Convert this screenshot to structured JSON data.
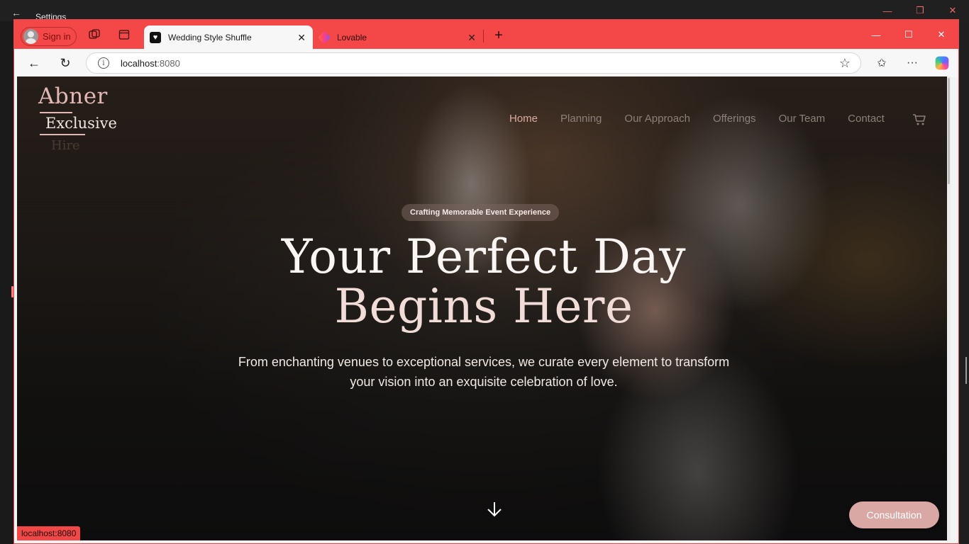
{
  "background_window": {
    "title": "Settings",
    "back_icon": "arrow-left-icon",
    "controls": [
      "minimize-icon",
      "restore-icon",
      "close-icon"
    ]
  },
  "browser": {
    "profile": {
      "label": "Sign in",
      "icon": "avatar-icon"
    },
    "tabs": [
      {
        "title": "Wedding Style Shuffle",
        "favicon": "heart-icon",
        "active": true
      },
      {
        "title": "Lovable",
        "favicon": "lovable-icon",
        "active": false
      }
    ],
    "address": {
      "host": "localhost",
      "port": ":8080"
    },
    "status_text": "localhost:8080",
    "accent_color": "#f44747"
  },
  "site": {
    "logo": {
      "line1": "Abner",
      "line2": "Exclusive",
      "line3": "Hire"
    },
    "nav": [
      "Home",
      "Planning",
      "Our Approach",
      "Offerings",
      "Our Team",
      "Contact"
    ],
    "active_nav": "Home",
    "badge": "Crafting Memorable Event Experience",
    "headline_line1": "Your Perfect Day",
    "headline_line2": "Begins Here",
    "subtitle": "From enchanting venues to exceptional services, we curate every element to transform your vision into an exquisite celebration of love.",
    "cta": "Consultation",
    "brand_color": "#d9a8a5"
  }
}
